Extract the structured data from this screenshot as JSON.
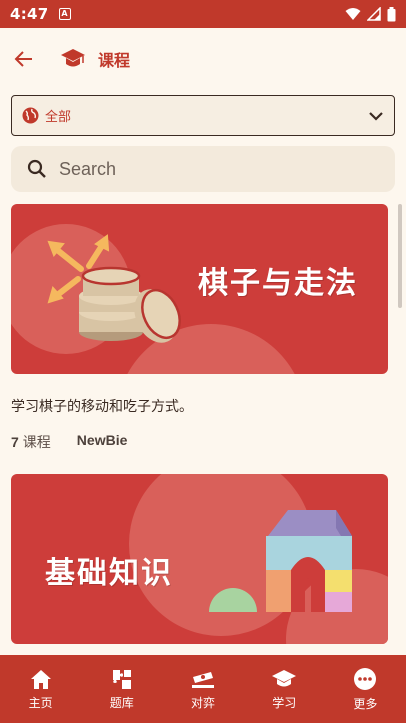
{
  "status": {
    "time": "4:47",
    "notif_letter": "A"
  },
  "header": {
    "title": "课程"
  },
  "filter": {
    "selected": "全部"
  },
  "search": {
    "placeholder": "Search"
  },
  "courses": [
    {
      "banner_title": "棋子与走法",
      "description": "学习棋子的移动和吃子方式。",
      "lesson_count": "7",
      "lesson_unit": "课程",
      "level": "NewBie"
    },
    {
      "banner_title": "基础知识"
    }
  ],
  "nav": [
    {
      "label": "主页",
      "icon": "home-icon"
    },
    {
      "label": "题库",
      "icon": "puzzle-icon"
    },
    {
      "label": "对弈",
      "icon": "board-icon"
    },
    {
      "label": "学习",
      "icon": "graduation-cap-icon"
    },
    {
      "label": "更多",
      "icon": "more-icon"
    }
  ],
  "colors": {
    "primary": "#c0392b",
    "banner": "#cd3d3a",
    "background": "#fdf7ee"
  }
}
